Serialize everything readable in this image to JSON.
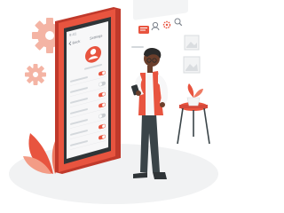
{
  "phone": {
    "status_time": "9:41",
    "header_left": "Back",
    "header_title": "Settings"
  },
  "icons": {
    "phone_back": "chevron-left-icon",
    "phone_avatar": "user-avatar-icon",
    "phone_toggle": "toggle-switch-icon",
    "float_chat": "chat-bubble-icon",
    "float_user": "user-icon",
    "float_gear": "gear-icon",
    "float_search": "search-icon",
    "gear_big": "gear-icon",
    "gear_small": "gear-icon",
    "frame": "image-icon",
    "plant": "plant-pot-icon",
    "stool": "side-table-icon"
  },
  "settings_rows": [
    {
      "toggle": "on"
    },
    {
      "toggle": "off"
    },
    {
      "toggle": "on"
    },
    {
      "toggle": "on"
    },
    {
      "toggle": "off"
    },
    {
      "toggle": "on"
    },
    {
      "toggle": "on"
    }
  ],
  "colors": {
    "accent": "#E8543F",
    "accent_light": "#F6B6A6",
    "phone_body": "#2F3437",
    "skin": "#6B3F2C",
    "pants": "#3A4448",
    "floor": "#F1F2F3"
  }
}
